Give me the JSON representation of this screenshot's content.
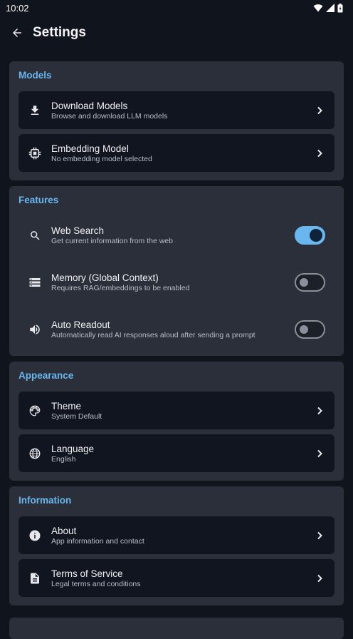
{
  "status_bar": {
    "time": "10:02"
  },
  "header": {
    "title": "Settings"
  },
  "sections": {
    "models": {
      "title": "Models",
      "items": [
        {
          "title": "Download Models",
          "subtitle": "Browse and download LLM models",
          "icon": "download-icon"
        },
        {
          "title": "Embedding Model",
          "subtitle": "No embedding model selected",
          "icon": "chip-icon"
        }
      ]
    },
    "features": {
      "title": "Features",
      "items": [
        {
          "title": "Web Search",
          "subtitle": "Get current information from the web",
          "icon": "search-icon",
          "enabled": true
        },
        {
          "title": "Memory (Global Context)",
          "subtitle": "Requires RAG/embeddings to be enabled",
          "icon": "storage-icon",
          "enabled": false
        },
        {
          "title": "Auto Readout",
          "subtitle": "Automatically read AI responses aloud after sending a prompt",
          "icon": "volume-icon",
          "enabled": false
        }
      ]
    },
    "appearance": {
      "title": "Appearance",
      "items": [
        {
          "title": "Theme",
          "subtitle": "System Default",
          "icon": "palette-icon"
        },
        {
          "title": "Language",
          "subtitle": "English",
          "icon": "globe-icon"
        }
      ]
    },
    "information": {
      "title": "Information",
      "items": [
        {
          "title": "About",
          "subtitle": "App information and contact",
          "icon": "info-icon"
        },
        {
          "title": "Terms of Service",
          "subtitle": "Legal terms and conditions",
          "icon": "document-icon"
        }
      ]
    }
  },
  "colors": {
    "accent": "#6ab7f0",
    "background": "#10141c",
    "section": "#2a2f3a",
    "card": "#111520"
  }
}
